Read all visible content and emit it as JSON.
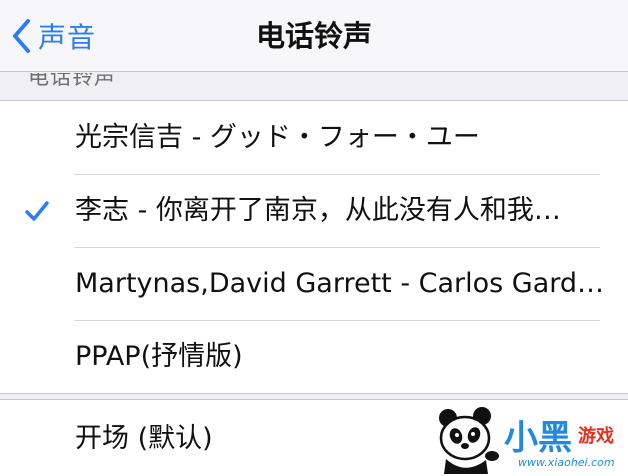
{
  "navbar": {
    "back_label": "声音",
    "title": "电话铃声"
  },
  "section": {
    "header": "电话铃声"
  },
  "ringtones": [
    {
      "label": "光宗信吉 - グッド・フォー・ユー",
      "selected": false
    },
    {
      "label": "李志 - 你离开了南京，从此没有人和我…",
      "selected": true
    },
    {
      "label": "Martynas,David Garrett - Carlos Gardel…",
      "selected": false
    },
    {
      "label": "PPAP(抒情版)",
      "selected": false
    }
  ],
  "second_list": [
    {
      "label": "开场 (默认)"
    }
  ],
  "watermark": {
    "logo": "小黑",
    "sub": "游戏",
    "url": "www.xiaohei.com"
  },
  "colors": {
    "accent": "#2b7cf6",
    "background": "#efeff4",
    "watermark_blue": "#1f8ae0",
    "watermark_red": "#e2321f"
  },
  "icons": {
    "back": "chevron-left-icon",
    "check": "checkmark-icon"
  }
}
